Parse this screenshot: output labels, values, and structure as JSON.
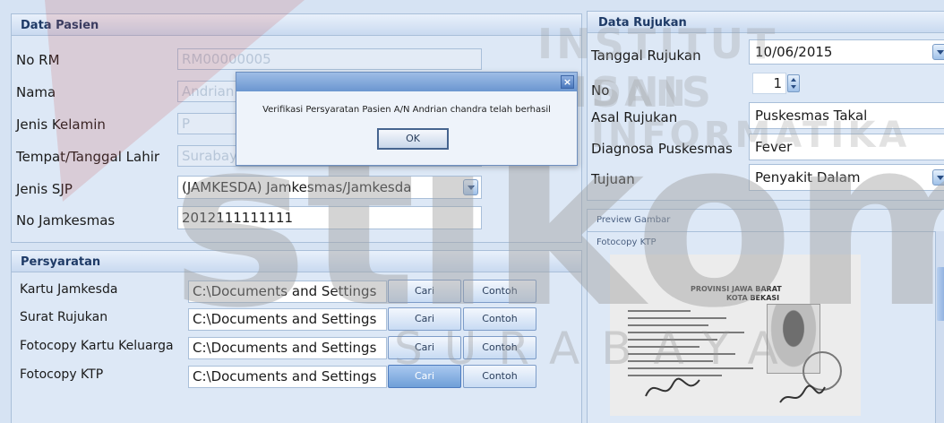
{
  "data_pasien": {
    "title": "Data Pasien",
    "no_rm": {
      "label": "No RM",
      "value": "RM00000005"
    },
    "nama": {
      "label": "Nama",
      "value": "Andrian c"
    },
    "jenis_kelamin": {
      "label": "Jenis Kelamin",
      "value": "P"
    },
    "ttl": {
      "label": "Tempat/Tanggal Lahir",
      "value": "Surabaya"
    },
    "jenis_sjp": {
      "label": "Jenis SJP",
      "value": "(JAMKESDA) Jamkesmas/Jamkesda"
    },
    "no_jamkesmas": {
      "label": "No Jamkesmas",
      "value": "2012111111111"
    }
  },
  "persyaratan": {
    "title": "Persyaratan",
    "rows": [
      {
        "label": "Kartu Jamkesda",
        "path": "C:\\Documents and Settings",
        "cari": "Cari",
        "contoh": "Contoh"
      },
      {
        "label": "Surat Rujukan",
        "path": "C:\\Documents and Settings",
        "cari": "Cari",
        "contoh": "Contoh"
      },
      {
        "label": "Fotocopy Kartu Keluarga",
        "path": "C:\\Documents and Settings",
        "cari": "Cari",
        "contoh": "Contoh"
      },
      {
        "label": "Fotocopy KTP",
        "path": "C:\\Documents and Settings",
        "cari": "Cari",
        "contoh": "Contoh"
      }
    ]
  },
  "data_rujukan": {
    "title": "Data Rujukan",
    "tanggal": {
      "label": "Tanggal Rujukan",
      "value": "10/06/2015"
    },
    "no": {
      "label": "No",
      "value": "1"
    },
    "asal": {
      "label": "Asal Rujukan",
      "value": "Puskesmas Takal"
    },
    "diagnosa": {
      "label": "Diagnosa Puskesmas",
      "value": "Fever"
    },
    "tujuan": {
      "label": "Tujuan",
      "value": "Penyakit Dalam"
    }
  },
  "preview": {
    "title": "Preview Gambar",
    "subtitle": "Fotocopy KTP",
    "ktp_header1": "PROVINSI JAWA BARAT",
    "ktp_header2": "KOTA BEKASI"
  },
  "dialog": {
    "message": "Verifikasi Persyaratan Pasien A/N Andrian chandra telah berhasil",
    "ok": "OK",
    "close": "×"
  },
  "watermark": {
    "top": "INSTITUT BISNIS",
    "mid": "DAN INFORMATIKA",
    "logo": "stikom",
    "bottom": "SURABAYA"
  },
  "colors": {
    "panel_bg": "#dde8f6",
    "header_text": "#1e3a66",
    "active_button": "#6f9fd8",
    "watermark": "#c8c8c8"
  }
}
